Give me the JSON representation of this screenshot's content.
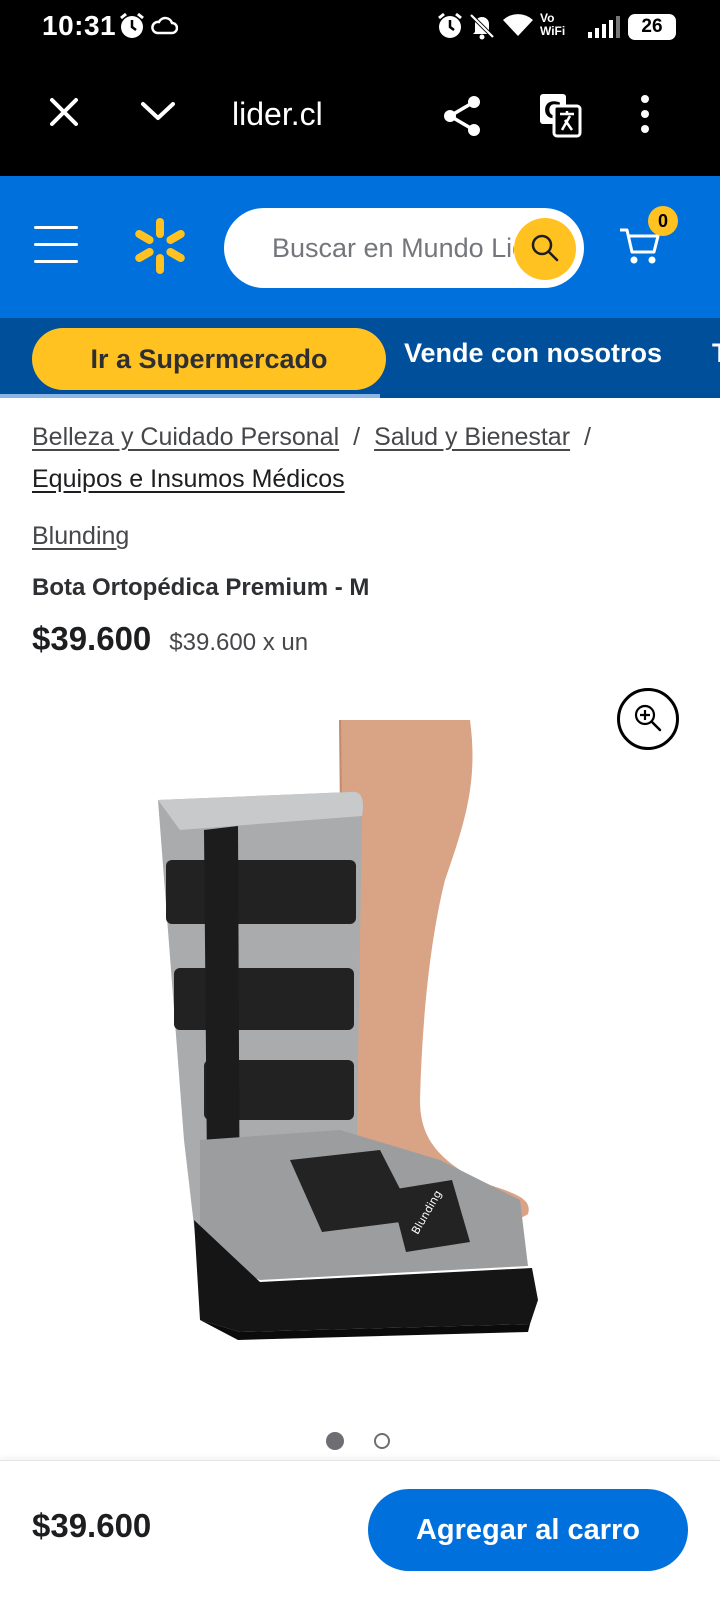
{
  "status_bar": {
    "time": "10:31",
    "network": "Vo WiFi",
    "network_line1": "Vo",
    "network_line2": "WiFi",
    "battery": "26",
    "icons": [
      "alarm-icon",
      "cloud-icon",
      "alarm-icon",
      "mute-icon",
      "wifi-icon",
      "signal-icon",
      "battery-icon"
    ]
  },
  "browser": {
    "url": "lider.cl",
    "icons": [
      "close-icon",
      "chevron-down-icon",
      "share-icon",
      "translate-icon",
      "more-vert-icon"
    ]
  },
  "header": {
    "search_placeholder": "Buscar en Mundo Lider",
    "cart_count": "0",
    "colors": {
      "primary": "#0071dc",
      "accent": "#ffc220",
      "nav_dark": "#004f9a"
    }
  },
  "nav": {
    "pill_label": "Ir a Supermercado",
    "link_label": "Vende con nosotros",
    "next_label": "T"
  },
  "breadcrumb": {
    "items": [
      "Belleza y Cuidado Personal",
      "Salud y Bienestar",
      "Equipos e Insumos Médicos"
    ],
    "separator": "/"
  },
  "product": {
    "brand": "Blunding",
    "title": "Bota Ortopédica Premium - M",
    "price": "$39.600",
    "unit_price": "$39.600 x un",
    "image_logo_text": "Blunding",
    "image_count": 2,
    "active_image": 1
  },
  "bottom_bar": {
    "price": "$39.600",
    "add_button": "Agregar al carro"
  }
}
